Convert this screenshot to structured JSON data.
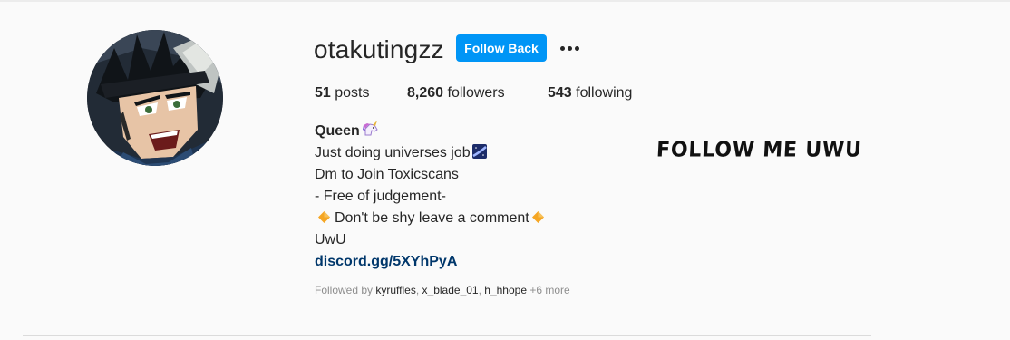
{
  "profile": {
    "username": "otakutingzz",
    "follow_button": "Follow Back",
    "more_options_icon": "ellipsis-icon",
    "avatar_icon": "anime-avatar"
  },
  "stats": {
    "posts_count": "51",
    "posts_label": "posts",
    "followers_count": "8,260",
    "followers_label": "followers",
    "following_count": "543",
    "following_label": "following"
  },
  "bio": {
    "name": "Queen",
    "name_emoji": "unicorn-emoji",
    "line1": "Just doing universes job",
    "line1_emoji": "milky-way-emoji",
    "line2": "Dm to Join Toxicscans",
    "line3": "- Free of judgement-",
    "line4": "Don't be shy leave a comment",
    "line4_emoji": "orange-diamond-emoji",
    "line5": "UwU",
    "link": "discord.gg/5XYhPyA"
  },
  "followed_by": {
    "prefix": "Followed by",
    "names": [
      "kyruffles",
      "x_blade_01",
      "h_hhope"
    ],
    "more": "+6 more"
  },
  "overlay": {
    "text": "FOLLOW ME UWU"
  },
  "colors": {
    "background": "#fafafa",
    "button_blue": "#0095f6",
    "link_navy": "#00376b",
    "muted_gray": "#8e8e8e"
  }
}
